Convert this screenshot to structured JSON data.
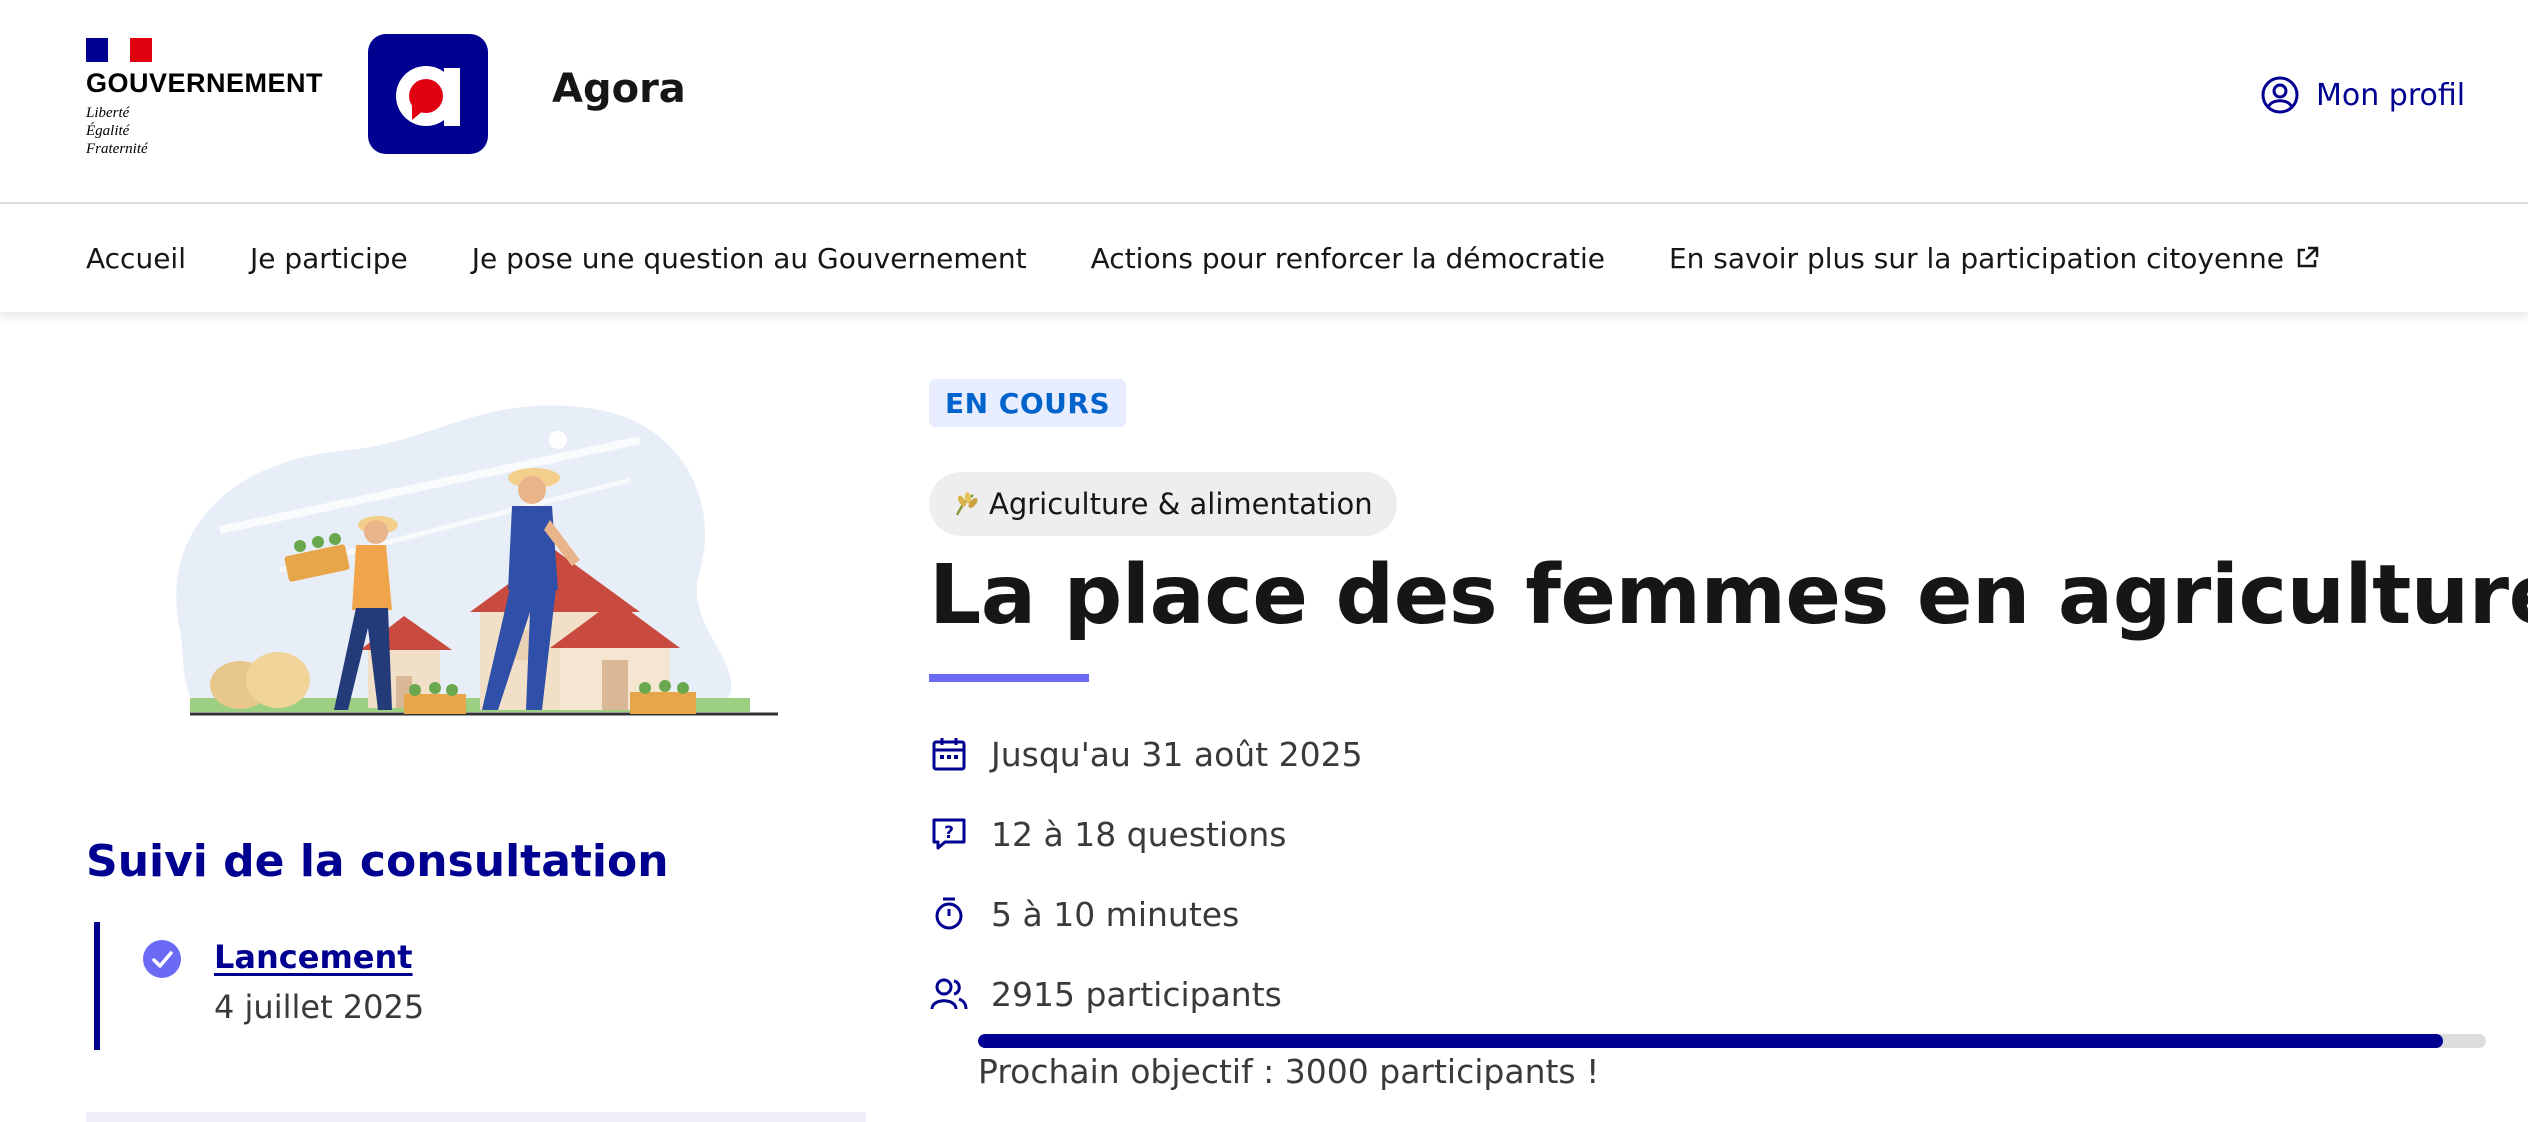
{
  "header": {
    "gov_name": "GOUVERNEMENT",
    "gov_motto": [
      "Liberté",
      "Égalité",
      "Fraternité"
    ],
    "app_name": "Agora",
    "profile_label": "Mon profil"
  },
  "nav": {
    "items": [
      {
        "label": "Accueil"
      },
      {
        "label": "Je participe"
      },
      {
        "label": "Je pose une question au Gouvernement"
      },
      {
        "label": "Actions pour renforcer la démocratie"
      },
      {
        "label": "En savoir plus sur la participation citoyenne",
        "icon": "external-link-icon"
      }
    ]
  },
  "consultation": {
    "status_badge": "EN COURS",
    "thematique": "Agriculture & alimentation",
    "title": "La place des femmes en agriculture",
    "end_date": "Jusqu'au 31 août 2025",
    "questions": "12 à 18 questions",
    "duration": "5 à 10 minutes",
    "participants": "2915 participants",
    "progress_fraction": 0.9717,
    "next_goal": "Prochain objectif : 3000 participants !"
  },
  "suivi": {
    "title": "Suivi de la consultation",
    "steps": [
      {
        "label": "Lancement",
        "date": "4 juillet 2025"
      }
    ]
  },
  "colors": {
    "primary": "#000091",
    "accent": "#6a6af4",
    "badge_bg": "#e8edff",
    "badge_text": "#0063cb",
    "marianne_red": "#e1000f"
  },
  "icons": {
    "calendar": "calendar-icon",
    "questions": "question-bubble-icon",
    "duration": "timer-icon",
    "participants": "users-icon",
    "profile": "user-circle-icon",
    "tag": "wheat-icon"
  }
}
